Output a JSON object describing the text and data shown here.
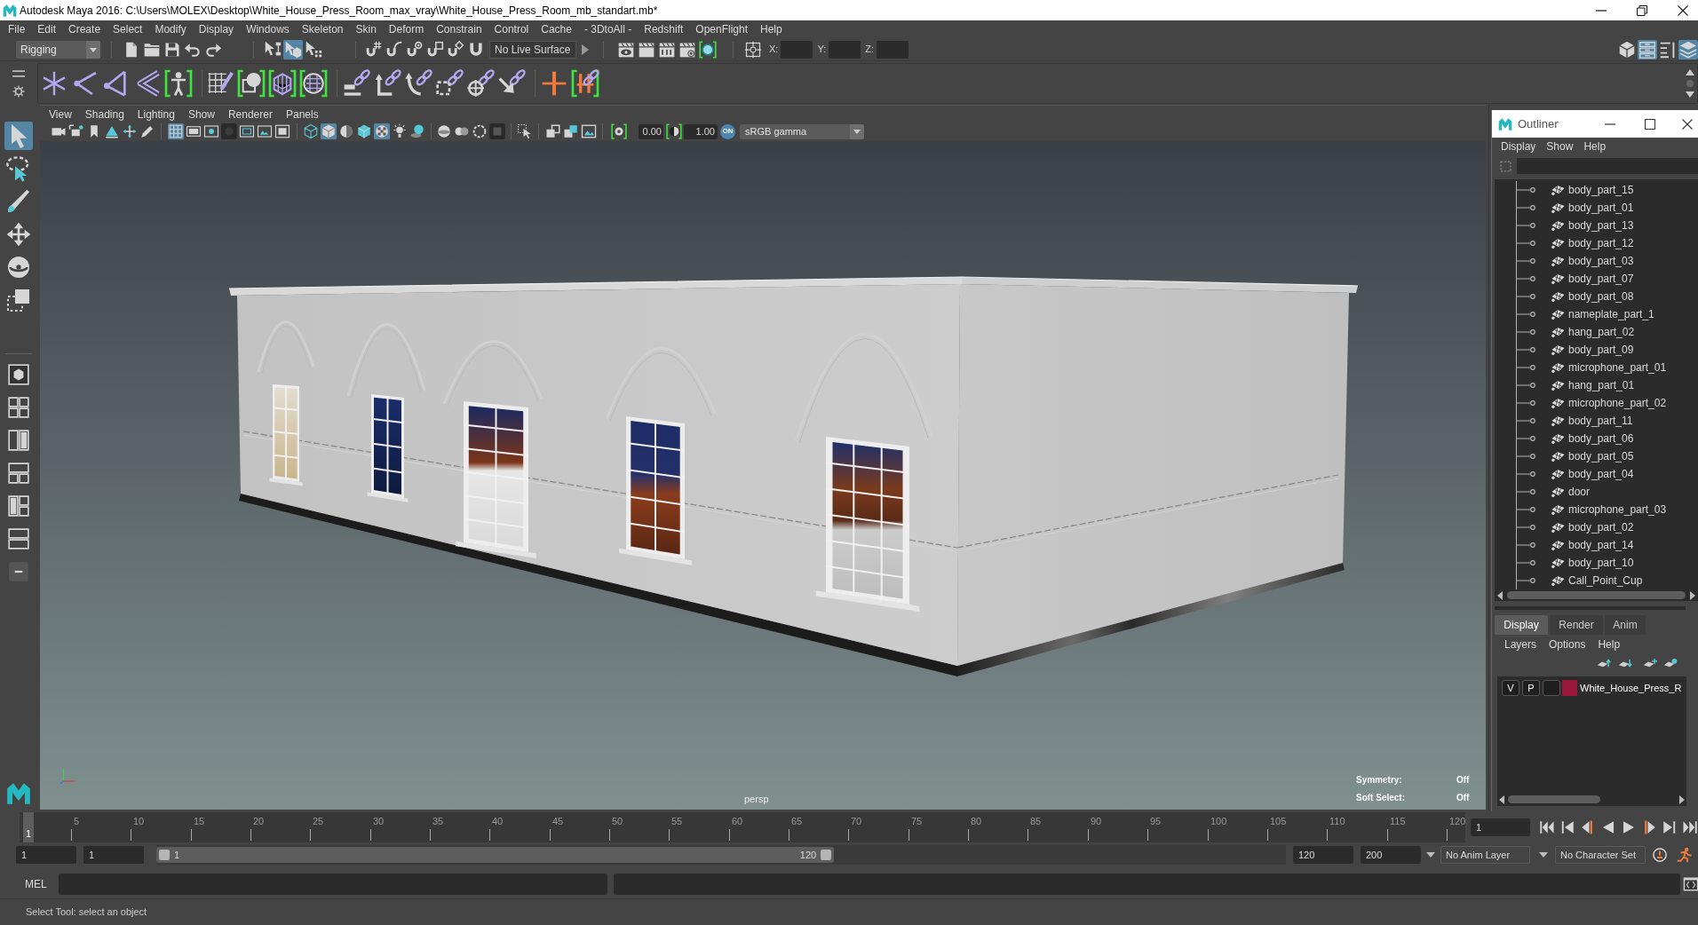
{
  "window": {
    "title": "Autodesk Maya 2016: C:\\Users\\MOLEX\\Desktop\\White_House_Press_Room_max_vray\\White_House_Press_Room_mb_standart.mb*"
  },
  "menu_bar": [
    "File",
    "Edit",
    "Create",
    "Select",
    "Modify",
    "Display",
    "Windows",
    "Skeleton",
    "Skin",
    "Deform",
    "Constrain",
    "Control",
    "Cache",
    "- 3DtoAll -",
    "Redshift",
    "OpenFlight",
    "Help"
  ],
  "status_line": {
    "menu_set": "Rigging",
    "selection_modes": [
      {
        "selected": false
      },
      {
        "selected": true
      },
      {
        "selected": false
      }
    ],
    "live_surface": "No Live Surface",
    "coordinates": [
      {
        "label": "X:"
      },
      {
        "label": "Y:"
      },
      {
        "label": "Z:"
      }
    ],
    "panel_toggles": [
      {
        "selected": false
      },
      {
        "selected": true
      },
      {
        "selected": false
      },
      {
        "selected": true
      }
    ]
  },
  "toolbox": {
    "tools": [
      {
        "selected": true
      },
      {
        "selected": false
      },
      {
        "selected": false
      },
      {
        "selected": false
      },
      {
        "selected": false
      },
      {
        "selected": false
      }
    ]
  },
  "viewport": {
    "menu": [
      "View",
      "Shading",
      "Lighting",
      "Show",
      "Renderer",
      "Panels"
    ],
    "toolbar": [
      {
        "selected": false
      },
      {
        "selected": false
      },
      {
        "selected": false
      },
      {
        "selected": false
      },
      {
        "selected": false
      },
      {
        "selected": false
      },
      {
        "selected": true
      },
      {
        "selected": false
      },
      {
        "selected": false
      },
      {
        "selected": false
      },
      {
        "selected": false
      },
      {
        "selected": false
      },
      {
        "selected": false
      },
      {
        "selected": false
      },
      {
        "selected": true
      },
      {
        "selected": false
      },
      {
        "selected": false
      },
      {
        "selected": true
      },
      {
        "selected": false
      },
      {
        "selected": false
      },
      {
        "selected": false
      },
      {
        "selected": false
      },
      {
        "selected": false
      },
      {
        "selected": false
      },
      {
        "selected": false
      },
      {
        "selected": false
      },
      {
        "selected": false
      },
      {
        "selected": false
      }
    ],
    "exposure": "0.00",
    "gamma": "1.00",
    "color_management": {
      "label": "ON",
      "on": true
    },
    "color_space": "sRGB gamma",
    "camera": "persp",
    "hud": [
      {
        "label": "Symmetry:",
        "value": "Off"
      },
      {
        "label": "Soft Select:",
        "value": "Off"
      }
    ]
  },
  "outliner": {
    "title": "Outliner",
    "menu": [
      "Display",
      "Show",
      "Help"
    ],
    "items": [
      {
        "name": "body_part_15",
        "selected": false
      },
      {
        "name": "body_part_01",
        "selected": false
      },
      {
        "name": "body_part_13",
        "selected": false
      },
      {
        "name": "body_part_12",
        "selected": false
      },
      {
        "name": "body_part_03",
        "selected": false
      },
      {
        "name": "body_part_07",
        "selected": false
      },
      {
        "name": "body_part_08",
        "selected": false
      },
      {
        "name": "nameplate_part_1",
        "selected": false
      },
      {
        "name": "hang_part_02",
        "selected": false
      },
      {
        "name": "body_part_09",
        "selected": false
      },
      {
        "name": "microphone_part_01",
        "selected": false
      },
      {
        "name": "hang_part_01",
        "selected": false
      },
      {
        "name": "microphone_part_02",
        "selected": false
      },
      {
        "name": "body_part_11",
        "selected": false
      },
      {
        "name": "body_part_06",
        "selected": false
      },
      {
        "name": "body_part_05",
        "selected": false
      },
      {
        "name": "body_part_04",
        "selected": false
      },
      {
        "name": "door",
        "selected": false
      },
      {
        "name": "microphone_part_03",
        "selected": false
      },
      {
        "name": "body_part_02",
        "selected": false
      },
      {
        "name": "body_part_14",
        "selected": false
      },
      {
        "name": "body_part_10",
        "selected": false
      },
      {
        "name": "Call_Point_Cup",
        "selected": false
      }
    ]
  },
  "layer_editor": {
    "tabs": [
      {
        "label": "Display",
        "selected": true
      },
      {
        "label": "Render",
        "selected": false
      },
      {
        "label": "Anim",
        "selected": false
      }
    ],
    "menu": [
      "Layers",
      "Options",
      "Help"
    ],
    "layers": [
      {
        "visibility": "V",
        "playback": "P",
        "color": "#98173a",
        "name": "White_House_Press_R"
      }
    ]
  },
  "time_slider": {
    "frames": [
      "5",
      "10",
      "15",
      "20",
      "25",
      "30",
      "35",
      "40",
      "45",
      "50",
      "55",
      "60",
      "65",
      "70",
      "75",
      "80",
      "85",
      "90",
      "95",
      "100",
      "105",
      "110",
      "115",
      "120"
    ],
    "current_frame": "1",
    "level": 0,
    "current_frame_field": "1"
  },
  "range_slider": {
    "start": "1",
    "playback_start": "1",
    "level": 0.6,
    "slider_start": "1",
    "slider_end": "120",
    "playback_end": "120",
    "end": "200",
    "anim_layer": "No Anim Layer",
    "character_set": "No Character Set"
  },
  "command_line": {
    "language": "MEL"
  },
  "help_line": "Select Tool: select an object"
}
